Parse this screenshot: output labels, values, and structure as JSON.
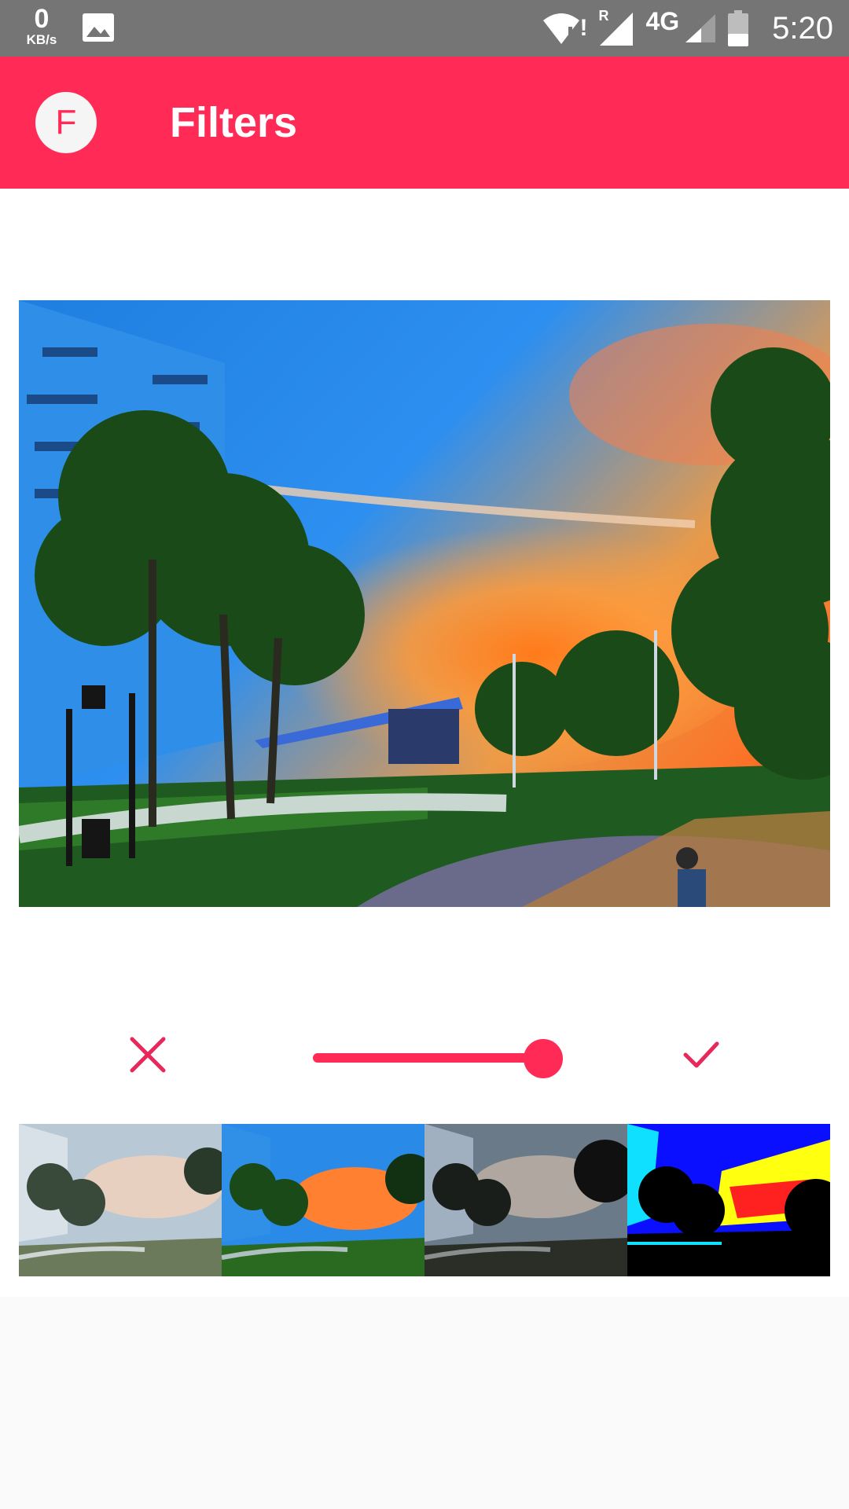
{
  "status_bar": {
    "net_speed": "0",
    "net_unit": "KB/s",
    "roaming": "R",
    "network_type": "4G",
    "time": "5:20",
    "icons": [
      "gallery-icon",
      "wifi-alert-icon",
      "signal-icon",
      "signal-weak-icon",
      "battery-icon"
    ]
  },
  "app_bar": {
    "avatar_letter": "F",
    "title": "Filters",
    "background": "#ff2a55"
  },
  "editor": {
    "cancel_icon": "close-icon",
    "apply_icon": "check-icon",
    "intensity_fraction": 1.0,
    "accent": "#ff2a55"
  },
  "filters": [
    {
      "name": "filter-grayscale"
    },
    {
      "name": "filter-vivid"
    },
    {
      "name": "filter-dark"
    },
    {
      "name": "filter-posterize"
    }
  ]
}
